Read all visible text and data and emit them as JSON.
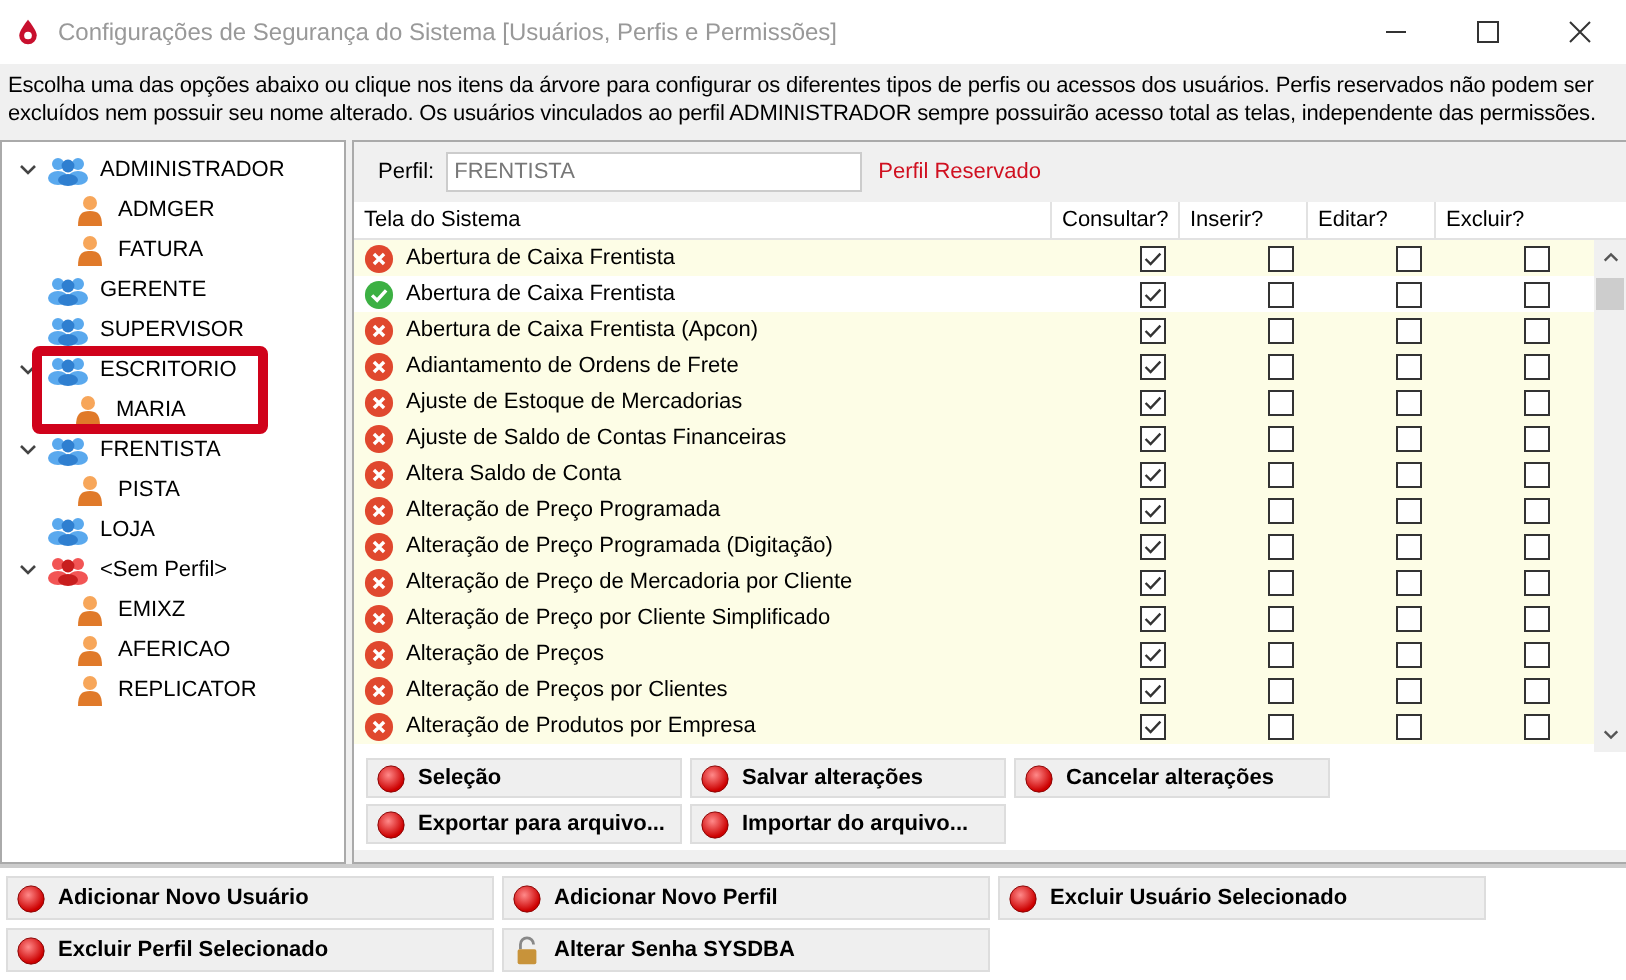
{
  "window": {
    "title": "Configurações de Segurança do Sistema [Usuários, Perfis e Permissões]"
  },
  "description": "Escolha uma das opções abaixo ou clique nos itens da árvore para configurar os diferentes tipos de perfis ou acessos dos usuários. Perfis reservados não podem ser excluídos nem possuir seu nome alterado. Os usuários vinculados ao perfil ADMINISTRADOR sempre possuirão acesso total as telas, independente das permissões.",
  "tree": [
    {
      "label": "ADMINISTRADOR",
      "kind": "profile",
      "expanded": true,
      "highlighted": false,
      "children": [
        {
          "label": "ADMGER",
          "kind": "user"
        },
        {
          "label": "FATURA",
          "kind": "user"
        }
      ]
    },
    {
      "label": "GERENTE",
      "kind": "profile",
      "expanded": false,
      "highlighted": false
    },
    {
      "label": "SUPERVISOR",
      "kind": "profile",
      "expanded": false,
      "highlighted": false
    },
    {
      "label": "ESCRITORIO",
      "kind": "profile",
      "expanded": true,
      "highlighted": true,
      "children": [
        {
          "label": "MARIA",
          "kind": "user"
        }
      ]
    },
    {
      "label": "FRENTISTA",
      "kind": "profile",
      "expanded": true,
      "highlighted": false,
      "children": [
        {
          "label": "PISTA",
          "kind": "user"
        }
      ]
    },
    {
      "label": "LOJA",
      "kind": "profile",
      "expanded": false,
      "highlighted": false
    },
    {
      "label": "<Sem Perfil>",
      "kind": "no-profile",
      "expanded": true,
      "highlighted": false,
      "children": [
        {
          "label": "EMIXZ",
          "kind": "user"
        },
        {
          "label": "AFERICAO",
          "kind": "user"
        },
        {
          "label": "REPLICATOR",
          "kind": "user"
        }
      ]
    }
  ],
  "profile": {
    "label": "Perfil:",
    "value": "FRENTISTA",
    "note": "Perfil Reservado"
  },
  "table": {
    "columns": [
      "Tela do Sistema",
      "Consultar?",
      "Inserir?",
      "Editar?",
      "Excluir?"
    ],
    "rows": [
      {
        "allowed": false,
        "name": "Abertura de Caixa Frentista",
        "checks": [
          true,
          false,
          false,
          false
        ]
      },
      {
        "allowed": true,
        "name": "Abertura de Caixa Frentista",
        "checks": [
          true,
          false,
          false,
          false
        ]
      },
      {
        "allowed": false,
        "name": "Abertura de Caixa Frentista (Apcon)",
        "checks": [
          true,
          false,
          false,
          false
        ]
      },
      {
        "allowed": false,
        "name": "Adiantamento de Ordens de Frete",
        "checks": [
          true,
          false,
          false,
          false
        ]
      },
      {
        "allowed": false,
        "name": "Ajuste de Estoque de Mercadorias",
        "checks": [
          true,
          false,
          false,
          false
        ]
      },
      {
        "allowed": false,
        "name": "Ajuste de Saldo de Contas Financeiras",
        "checks": [
          true,
          false,
          false,
          false
        ]
      },
      {
        "allowed": false,
        "name": "Altera Saldo de Conta",
        "checks": [
          true,
          false,
          false,
          false
        ]
      },
      {
        "allowed": false,
        "name": "Alteração de Preço Programada",
        "checks": [
          true,
          false,
          false,
          false
        ]
      },
      {
        "allowed": false,
        "name": "Alteração de Preço Programada (Digitação)",
        "checks": [
          true,
          false,
          false,
          false
        ]
      },
      {
        "allowed": false,
        "name": "Alteração de Preço de Mercadoria por Cliente",
        "checks": [
          true,
          false,
          false,
          false
        ]
      },
      {
        "allowed": false,
        "name": "Alteração de Preço por Cliente Simplificado",
        "checks": [
          true,
          false,
          false,
          false
        ]
      },
      {
        "allowed": false,
        "name": "Alteração de Preços",
        "checks": [
          true,
          false,
          false,
          false
        ]
      },
      {
        "allowed": false,
        "name": "Alteração de Preços por Clientes",
        "checks": [
          true,
          false,
          false,
          false
        ]
      },
      {
        "allowed": false,
        "name": "Alteração de Produtos por Empresa",
        "checks": [
          true,
          false,
          false,
          false
        ]
      }
    ]
  },
  "panel_buttons": [
    [
      {
        "label": "Seleção",
        "kind": "dot"
      },
      {
        "label": "Salvar alterações",
        "kind": "dot"
      },
      {
        "label": "Cancelar alterações",
        "kind": "dot"
      }
    ],
    [
      {
        "label": "Exportar para arquivo...",
        "kind": "dot"
      },
      {
        "label": "Importar do arquivo...",
        "kind": "dot"
      }
    ]
  ],
  "bottom_buttons": [
    [
      {
        "label": "Adicionar Novo Usuário",
        "kind": "dot"
      },
      {
        "label": "Adicionar Novo Perfil",
        "kind": "dot"
      },
      {
        "label": "Excluir Usuário Selecionado",
        "kind": "dot"
      }
    ],
    [
      {
        "label": "Excluir Perfil Selecionado",
        "kind": "dot"
      },
      {
        "label": "Alterar Senha SYSDBA",
        "kind": "lock"
      }
    ]
  ]
}
